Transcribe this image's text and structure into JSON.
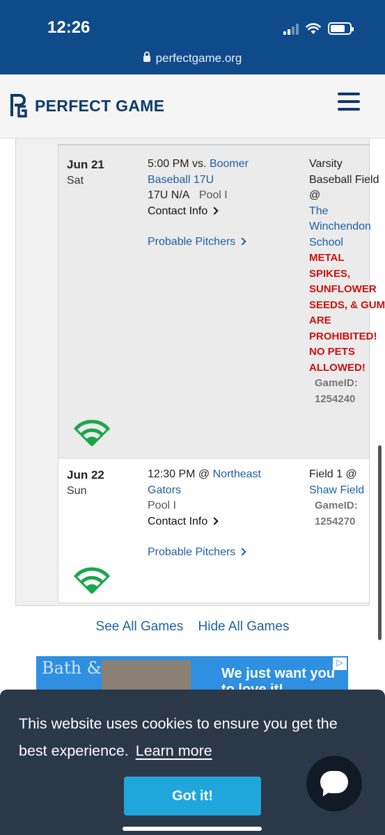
{
  "status_bar": {
    "time": "12:26"
  },
  "browser": {
    "url": "perfectgame.org"
  },
  "header": {
    "brand": "PERFECT GAME"
  },
  "games": [
    {
      "date": "Jun 21",
      "dow": "Sat",
      "time_vs": "5:00 PM vs.",
      "opponent": "Boomer Baseball 17U",
      "division": "17U N/A",
      "pool": "Pool I",
      "contact_label": "Contact Info",
      "pitchers_label": "Probable Pitchers",
      "field_text": "Varsity Baseball Field @",
      "venue": "The Winchendon School",
      "notice": "METAL SPIKES, SUNFLOWER SEEDS, & GUM ARE PROHIBITED! NO PETS ALLOWED!",
      "gameid_label": "GameID:",
      "gameid": "1254240"
    },
    {
      "date": "Jun 22",
      "dow": "Sun",
      "time_vs": "12:30 PM @",
      "opponent": "Northeast Gators",
      "pool": "Pool I",
      "contact_label": "Contact Info",
      "pitchers_label": "Probable Pitchers",
      "field_text": "Field 1 @",
      "venue": "Shaw Field",
      "gameid_label": "GameID:",
      "gameid": "1254270"
    }
  ],
  "links": {
    "see_all": "See All Games",
    "hide_all": "Hide All Games"
  },
  "ad": {
    "logo": "Bath & Body",
    "text": "We just want you to love it!"
  },
  "cookie": {
    "message": "This website uses cookies to ensure you get the best experience.",
    "learn_more": "Learn more",
    "button": "Got it!"
  },
  "colors": {
    "brand_blue": "#0f4a8a",
    "link": "#1f5fa5",
    "warning": "#cc1010",
    "live_green": "#1aa64a",
    "cookie_bg": "#2b3847",
    "button": "#1fa6db"
  }
}
